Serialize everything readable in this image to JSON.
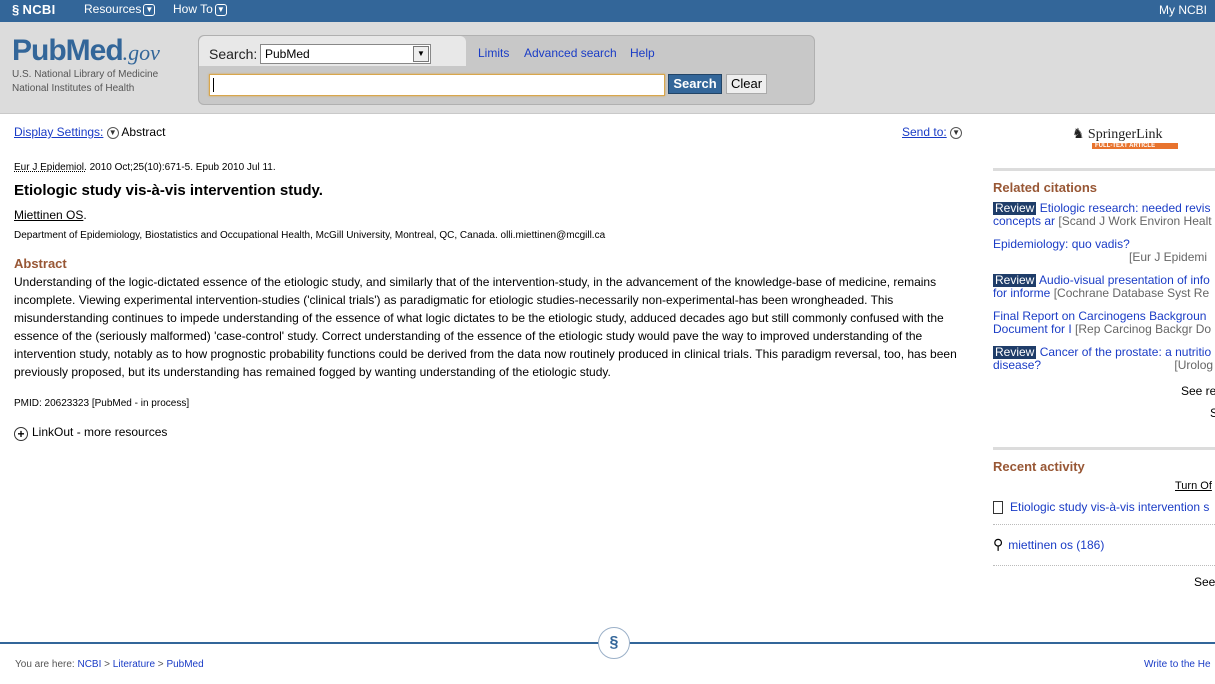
{
  "ncbi_bar": {
    "logo": "NCBI",
    "resources": "Resources",
    "howto": "How To",
    "myncbi": "My NCBI"
  },
  "brand": {
    "pub": "Pub",
    "med": "Med",
    "gov": ".gov",
    "line1": "U.S. National Library of Medicine",
    "line2": "National Institutes of Health"
  },
  "search": {
    "label": "Search:",
    "db_selected": "PubMed",
    "query_value": "",
    "search_btn": "Search",
    "clear_btn": "Clear",
    "links": [
      "Limits",
      "Advanced search",
      "Help"
    ]
  },
  "main": {
    "display_settings": "Display Settings:",
    "display_format": "Abstract",
    "send_to": "Send to:",
    "journal": "Eur J Epidemiol.",
    "citation_rest": " 2010 Oct;25(10):671-5. Epub 2010 Jul 11.",
    "title": "Etiologic study vis-à-vis intervention study.",
    "author": "Miettinen OS",
    "affiliation": "Department of Epidemiology, Biostatistics and Occupational Health, McGill University, Montreal, QC, Canada. olli.miettinen@mcgill.ca",
    "abstract_heading": "Abstract",
    "abstract_text": "Understanding of the logic-dictated essence of the etiologic study, and similarly that of the intervention-study, in the advancement of the knowledge-base of medicine, remains incomplete. Viewing experimental intervention-studies ('clinical trials') as paradigmatic for etiologic studies-necessarily non-experimental-has been wrongheaded. This misunderstanding continues to impede understanding of the essence of what logic dictates to be the etiologic study, adduced decades ago but still commonly confused with the essence of the (seriously malformed) 'case-control' study. Correct understanding of the essence of the etiologic study would pave the way to improved understanding of the intervention study, notably as to how prognostic probability functions could be derived from the data now routinely produced in clinical trials. This paradigm reversal, too, has been previously proposed, but its understanding has remained fogged by wanting understanding of the etiologic study.",
    "pmid": "PMID: 20623323 [PubMed - in process]",
    "linkout": "LinkOut - more resources"
  },
  "sidebar": {
    "springer_name": "SpringerLink",
    "springer_tag": "FULL-TEXT ARTICLE",
    "related_heading": "Related citations",
    "related": [
      {
        "badge": "Review",
        "l1": "Etiologic research: needed revis",
        "l2": "concepts ar",
        "journal": "[Scand J Work Environ Healt"
      },
      {
        "badge": "",
        "l1": "Epidemiology: quo vadis?",
        "l2": "",
        "journal": "[Eur J Epidemi"
      },
      {
        "badge": "Review",
        "l1": "Audio-visual presentation of info",
        "l2": "for informe",
        "journal": "[Cochrane Database Syst Re"
      },
      {
        "badge": "",
        "l1": "Final Report on Carcinogens Backgroun",
        "l2": "Document for I",
        "journal": "[Rep Carcinog Backgr Do"
      },
      {
        "badge": "Review",
        "l1": "Cancer of the prostate: a nutritio",
        "l2": "disease?",
        "journal": "[Urolog"
      }
    ],
    "see_reviews": "See re",
    "see_all": "S",
    "recent_heading": "Recent activity",
    "turn_off": "Turn Of",
    "recent_item1": "Etiologic study vis-à-vis intervention s",
    "recent_item2": "miettinen os (186)",
    "see_more": "See"
  },
  "footer": {
    "you_are_here": "You are here:",
    "crumb1": "NCBI",
    "crumb2": "Literature",
    "crumb3": "PubMed",
    "write": "Write to the He"
  }
}
